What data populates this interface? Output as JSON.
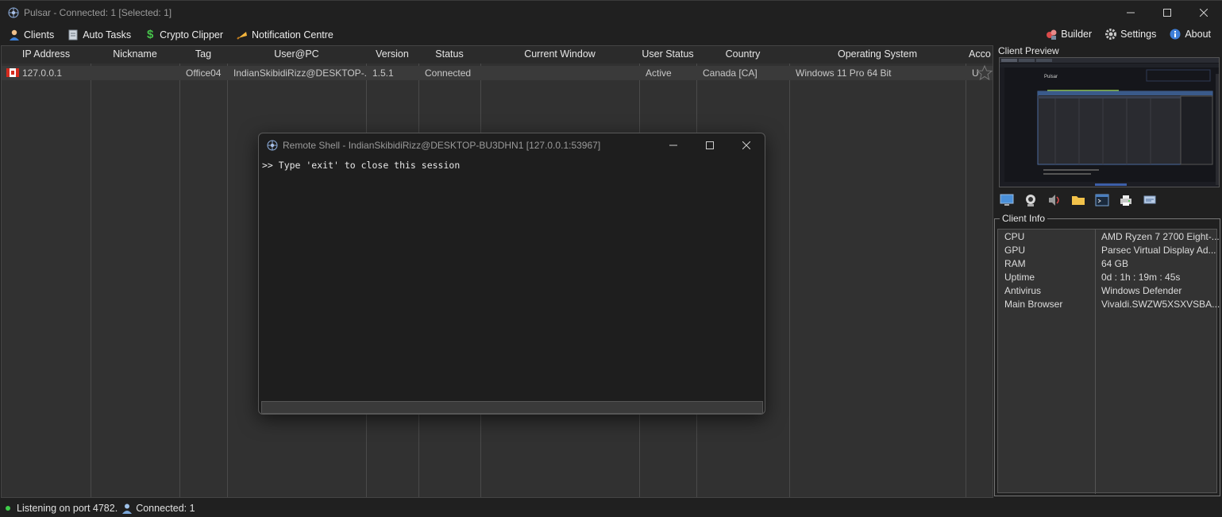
{
  "window": {
    "title": "Pulsar - Connected: 1 [Selected: 1]"
  },
  "menu": {
    "left": [
      {
        "label": "Clients",
        "icon": "user-icon"
      },
      {
        "label": "Auto Tasks",
        "icon": "tasks-icon"
      },
      {
        "label": "Crypto Clipper",
        "icon": "dollar-icon"
      },
      {
        "label": "Notification Centre",
        "icon": "bell-icon"
      }
    ],
    "right": [
      {
        "label": "Builder",
        "icon": "builder-icon"
      },
      {
        "label": "Settings",
        "icon": "gear-icon"
      },
      {
        "label": "About",
        "icon": "info-icon"
      }
    ]
  },
  "table": {
    "columns": [
      "IP Address",
      "Nickname",
      "Tag",
      "User@PC",
      "Version",
      "Status",
      "Current Window",
      "User Status",
      "Country",
      "Operating System",
      "Acco"
    ],
    "rows": [
      {
        "ip": "127.0.0.1",
        "nickname": "",
        "tag": "Office04",
        "user_pc": "IndianSkibidiRizz@DESKTOP-...",
        "version": "1.5.1",
        "status": "Connected",
        "current_window": "",
        "user_status": "Active",
        "country": "Canada [CA]",
        "os": "Windows 11 Pro 64 Bit",
        "account": "U"
      }
    ]
  },
  "right_panel": {
    "preview_title": "Client Preview",
    "preview_text": "Pulsar",
    "tools": [
      "remote-desktop-icon",
      "webcam-icon",
      "audio-icon",
      "folder-icon",
      "shell-icon",
      "printer-icon",
      "network-icon"
    ],
    "client_info_title": "Client Info",
    "client_info": [
      {
        "key": "CPU",
        "value": "AMD Ryzen 7 2700 Eight-..."
      },
      {
        "key": "GPU",
        "value": "Parsec Virtual Display Ad..."
      },
      {
        "key": "RAM",
        "value": "64 GB"
      },
      {
        "key": "Uptime",
        "value": "0d : 1h : 19m : 45s"
      },
      {
        "key": "Antivirus",
        "value": "Windows Defender"
      },
      {
        "key": "Main Browser",
        "value": "Vivaldi.SWZW5XSXVSBA..."
      }
    ]
  },
  "status": {
    "listening": "Listening on port 4782.",
    "connected": "Connected: 1"
  },
  "dialog": {
    "title": "Remote Shell - IndianSkibidiRizz@DESKTOP-BU3DHN1 [127.0.0.1:53967]",
    "console_text": ">> Type 'exit' to close this session",
    "input_value": ""
  },
  "colors": {
    "status_dot": "#3fce4a",
    "background": "#202020"
  }
}
